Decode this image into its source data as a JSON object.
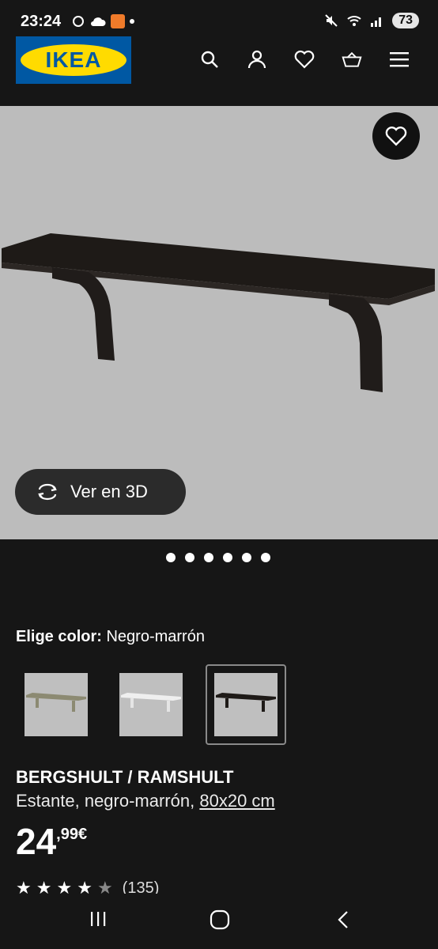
{
  "status_bar": {
    "time": "23:24",
    "battery": "73"
  },
  "header": {
    "logo_text": "IKEA",
    "icons": [
      "search-icon",
      "user-icon",
      "heart-icon",
      "basket-icon",
      "menu-icon"
    ]
  },
  "hero": {
    "view_3d_label": "Ver en 3D"
  },
  "gallery": {
    "dot_count": 6
  },
  "color_select": {
    "label": "Elige color:",
    "value": "Negro-marrón"
  },
  "product": {
    "name": "BERGSHULT / RAMSHULT",
    "description": "Estante, negro-marrón,",
    "size": "80x20 cm",
    "price_int": "24",
    "price_dec": ",99€",
    "rating_count": "(135)"
  },
  "colors": {
    "ikea_blue": "#0058a3",
    "ikea_yellow": "#ffdb00",
    "background": "#161616"
  }
}
